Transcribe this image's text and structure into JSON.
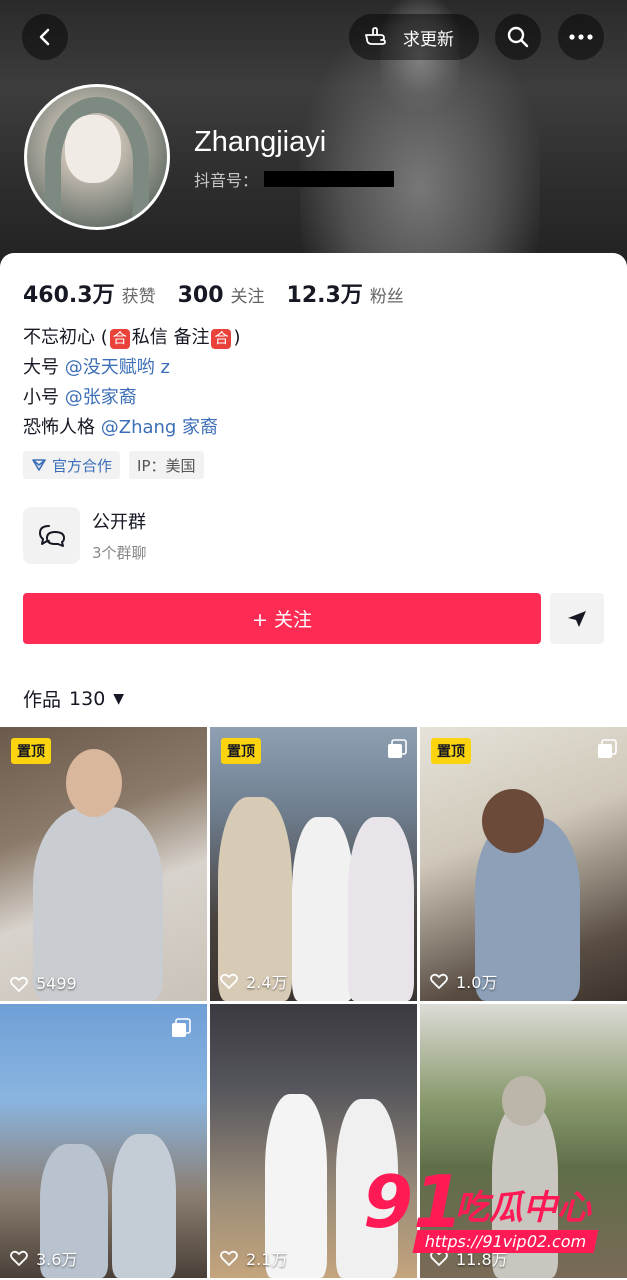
{
  "header": {
    "back_label": "",
    "update_label": "求更新",
    "username": "Zhangjiayi",
    "douyin_id_label": "抖音号："
  },
  "stats": [
    {
      "value": "460.3万",
      "label": "获赞"
    },
    {
      "value": "300",
      "label": "关注"
    },
    {
      "value": "12.3万",
      "label": "粉丝"
    }
  ],
  "bio": {
    "line1_prefix": "不忘初心 (",
    "line1_glyph1": "合",
    "line1_mid": "私信 备注",
    "line1_glyph2": "合",
    "line1_suffix": ")",
    "line2_prefix": "大号 ",
    "line2_link": "@没天赋哟 z",
    "line3_prefix": "小号 ",
    "line3_link": "@张家裔",
    "line4_prefix": "恐怖人格 ",
    "line4_link": "@Zhang 家裔"
  },
  "tags": {
    "official": "官方合作",
    "ip": "IP：美国"
  },
  "group": {
    "title": "公开群",
    "subtitle": "3个群聊"
  },
  "follow_button": "+ 关注",
  "works": {
    "label": "作品",
    "count": "130"
  },
  "videos": [
    {
      "pinned": "置顶",
      "likes": "5499",
      "multi": false
    },
    {
      "pinned": "置顶",
      "likes": "2.4万",
      "multi": true
    },
    {
      "pinned": "置顶",
      "likes": "1.0万",
      "multi": true
    },
    {
      "pinned": "",
      "likes": "3.6万",
      "multi": true
    },
    {
      "pinned": "",
      "likes": "2.1万",
      "multi": false
    },
    {
      "pinned": "",
      "likes": "11.8万",
      "multi": false
    }
  ],
  "watermark": {
    "number": "91",
    "text": "吃瓜中心",
    "url": "https://91vip02.com"
  },
  "colors": {
    "accent": "#fe2c55",
    "link": "#3c6fb7",
    "pin": "#fcd30f"
  }
}
